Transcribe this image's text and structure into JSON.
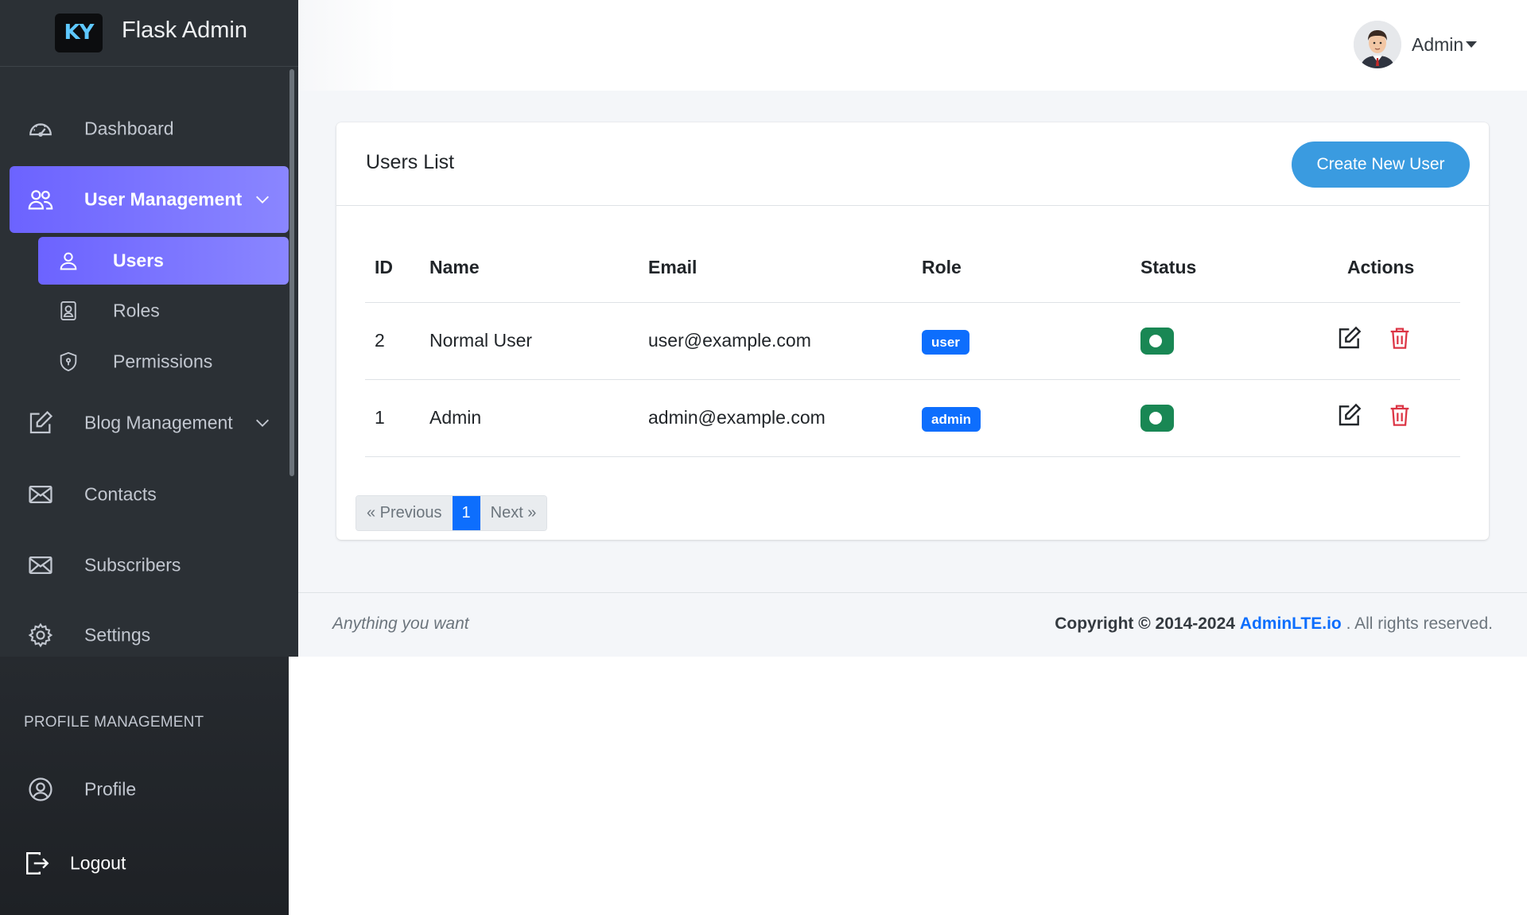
{
  "brand": {
    "logo_text": "KY",
    "title": "Flask Admin"
  },
  "sidebar": {
    "items": [
      {
        "label": "Dashboard",
        "icon": "gauge-icon"
      },
      {
        "label": "User Management",
        "icon": "users-icon",
        "active": true,
        "expanded": true
      },
      {
        "label": "Blog Management",
        "icon": "edit-icon"
      },
      {
        "label": "Contacts",
        "icon": "envelope-icon"
      },
      {
        "label": "Subscribers",
        "icon": "envelope-icon"
      },
      {
        "label": "Settings",
        "icon": "gear-icon"
      }
    ],
    "sub_items": [
      {
        "label": "Users",
        "icon": "user-icon",
        "active": true
      },
      {
        "label": "Roles",
        "icon": "id-badge-icon"
      },
      {
        "label": "Permissions",
        "icon": "shield-icon"
      }
    ],
    "section_header": "PROFILE MANAGEMENT",
    "profile": {
      "label": "Profile",
      "icon": "user-circle-icon"
    },
    "logout": {
      "label": "Logout",
      "icon": "logout-icon"
    }
  },
  "topbar": {
    "user_name": "Admin"
  },
  "card": {
    "title": "Users List",
    "create_button": "Create New User",
    "columns": [
      "ID",
      "Name",
      "Email",
      "Role",
      "Status",
      "Actions"
    ],
    "rows": [
      {
        "id": "2",
        "name": "Normal User",
        "email": "user@example.com",
        "role": "user",
        "status": "active"
      },
      {
        "id": "1",
        "name": "Admin",
        "email": "admin@example.com",
        "role": "admin",
        "status": "active"
      }
    ]
  },
  "pagination": {
    "previous": "« Previous",
    "current": "1",
    "next": "Next »"
  },
  "footer": {
    "left": "Anything you want",
    "copyright": "Copyright © 2014-2024",
    "link": "AdminLTE.io",
    "suffix": ". All rights reserved."
  },
  "colors": {
    "sidebar_bg": "#2b3035",
    "active_gradient_start": "#6c63ff",
    "primary": "#0d6efd",
    "success": "#198754",
    "danger": "#dc3545",
    "create_button": "#3a9be0"
  }
}
